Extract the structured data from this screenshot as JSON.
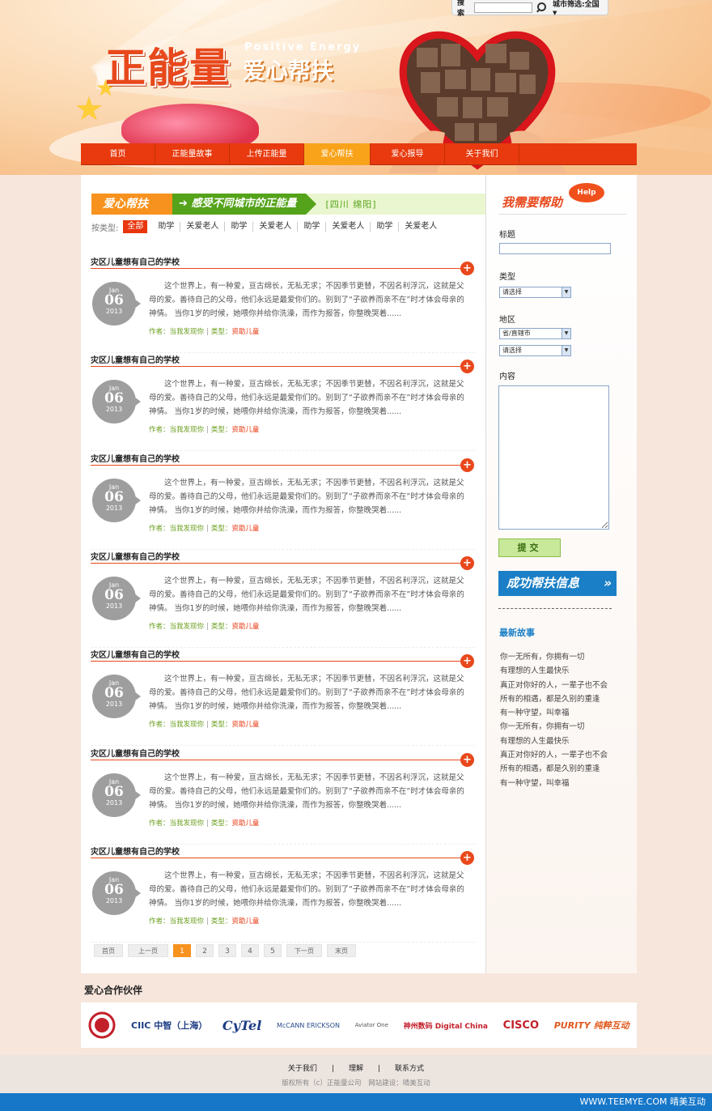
{
  "header": {
    "search_label": "搜索",
    "city_filter": "城市筛选:全国",
    "logo_main": "正能量",
    "logo_en": "Positive Energy",
    "logo_sub": "爱心帮扶"
  },
  "nav": {
    "items": [
      "首页",
      "正能量故事",
      "上传正能量",
      "爱心帮扶",
      "爱心报导",
      "关于我们"
    ],
    "active": "爱心帮扶"
  },
  "section": {
    "title": "爱心帮扶",
    "subtitle": "感受不同城市的正能量",
    "city": "[四川  绵阳]"
  },
  "filter": {
    "label": "按类型:",
    "items": [
      "全部",
      "助学",
      "关爱老人",
      "助学",
      "关爱老人",
      "助学",
      "关爱老人",
      "助学",
      "关爱老人"
    ]
  },
  "articles": [
    {
      "title": "灾区儿童想有自己的学校",
      "month": "Jan",
      "day": "06",
      "year": "2013",
      "body": "这个世界上，有一种爱，亘古绵长，无私无求；不因季节更替，不因名利浮沉，这就是父母的爱。善待自己的父母，他们永远是最爱你们的。别到了“子欲养而亲不在”时才体会母亲的神情。 当你1岁的时候，她喂你并给你洗澡，而作为报答，你整晚哭着......",
      "author": "作者：当我发现你",
      "category_label": "类型：",
      "category": "资助儿童"
    },
    {
      "title": "灾区儿童想有自己的学校",
      "month": "Jan",
      "day": "06",
      "year": "2013",
      "body": "这个世界上，有一种爱，亘古绵长，无私无求；不因季节更替，不因名利浮沉，这就是父母的爱。善待自己的父母，他们永远是最爱你们的。别到了“子欲养而亲不在”时才体会母亲的神情。 当你1岁的时候，她喂你并给你洗澡，而作为报答，你整晚哭着......",
      "author": "作者：当我发现你",
      "category_label": "类型：",
      "category": "资助儿童"
    },
    {
      "title": "灾区儿童想有自己的学校",
      "month": "Jan",
      "day": "06",
      "year": "2013",
      "body": "这个世界上，有一种爱，亘古绵长，无私无求；不因季节更替，不因名利浮沉，这就是父母的爱。善待自己的父母，他们永远是最爱你们的。别到了“子欲养而亲不在”时才体会母亲的神情。 当你1岁的时候，她喂你并给你洗澡，而作为报答，你整晚哭着......",
      "author": "作者：当我发现你",
      "category_label": "类型：",
      "category": "资助儿童"
    },
    {
      "title": "灾区儿童想有自己的学校",
      "month": "Jan",
      "day": "06",
      "year": "2013",
      "body": "这个世界上，有一种爱，亘古绵长，无私无求；不因季节更替，不因名利浮沉，这就是父母的爱。善待自己的父母，他们永远是最爱你们的。别到了“子欲养而亲不在”时才体会母亲的神情。 当你1岁的时候，她喂你并给你洗澡，而作为报答，你整晚哭着......",
      "author": "作者：当我发现你",
      "category_label": "类型：",
      "category": "资助儿童"
    },
    {
      "title": "灾区儿童想有自己的学校",
      "month": "Jan",
      "day": "06",
      "year": "2013",
      "body": "这个世界上，有一种爱，亘古绵长，无私无求；不因季节更替，不因名利浮沉，这就是父母的爱。善待自己的父母，他们永远是最爱你们的。别到了“子欲养而亲不在”时才体会母亲的神情。 当你1岁的时候，她喂你并给你洗澡，而作为报答，你整晚哭着......",
      "author": "作者：当我发现你",
      "category_label": "类型：",
      "category": "资助儿童"
    },
    {
      "title": "灾区儿童想有自己的学校",
      "month": "Jan",
      "day": "06",
      "year": "2013",
      "body": "这个世界上，有一种爱，亘古绵长，无私无求；不因季节更替，不因名利浮沉，这就是父母的爱。善待自己的父母，他们永远是最爱你们的。别到了“子欲养而亲不在”时才体会母亲的神情。 当你1岁的时候，她喂你并给你洗澡，而作为报答，你整晚哭着......",
      "author": "作者：当我发现你",
      "category_label": "类型：",
      "category": "资助儿童"
    },
    {
      "title": "灾区儿童想有自己的学校",
      "month": "Jan",
      "day": "06",
      "year": "2013",
      "body": "这个世界上，有一种爱，亘古绵长，无私无求；不因季节更替，不因名利浮沉，这就是父母的爱。善待自己的父母，他们永远是最爱你们的。别到了“子欲养而亲不在”时才体会母亲的神情。 当你1岁的时候，她喂你并给你洗澡，而作为报答，你整晚哭着......",
      "author": "作者：当我发现你",
      "category_label": "类型：",
      "category": "资助儿童"
    }
  ],
  "pager": {
    "first": "首页",
    "prev": "上一页",
    "pages": [
      "1",
      "2",
      "3",
      "4",
      "5"
    ],
    "current": "1",
    "next": "下一页",
    "last": "末页"
  },
  "sidebar": {
    "help_title": "我需要帮助",
    "help_badge": "Help",
    "title_label": "标题",
    "type_label": "类型",
    "type_select": "请选择",
    "region_label": "地区",
    "province_select": "省/直辖市",
    "city_select": "请选择",
    "content_label": "内容",
    "submit": "提交",
    "success_banner": "成功帮扶信息",
    "latest_title": "最新故事",
    "stories": [
      "你一无所有，你拥有一切",
      "有理想的人生最快乐",
      "真正对你好的人，一辈子也不会",
      "所有的相遇，都是久别的重逢",
      "有一种守望，叫幸福",
      "你一无所有，你拥有一切",
      "有理想的人生最快乐",
      "真正对你好的人，一辈子也不会",
      "所有的相遇，都是久别的重逢",
      "有一种守望，叫幸福"
    ]
  },
  "partners": {
    "title": "爱心合作伙伴",
    "logos": [
      "CIIC 中智（上海）",
      "CyTel",
      "McCANN ERICKSON",
      "Aviator One",
      "神州数码 Digital China",
      "CISCO",
      "PURITY 纯粹互动"
    ]
  },
  "footer": {
    "links": [
      "关于我们",
      "|",
      "理解",
      "|",
      "联系方式"
    ],
    "copyright": "版权所有（c）正能量公司",
    "built_by": "网站建设：晴美互动",
    "strip": "WWW.TEEMYE.COM  晴美互动"
  },
  "colors": {
    "nav_bg": "#e83a0e",
    "nav_active": "#f9a31b",
    "accent_orange": "#e8481c",
    "accent_green": "#54a31a",
    "accent_blue": "#1a7fc6"
  }
}
